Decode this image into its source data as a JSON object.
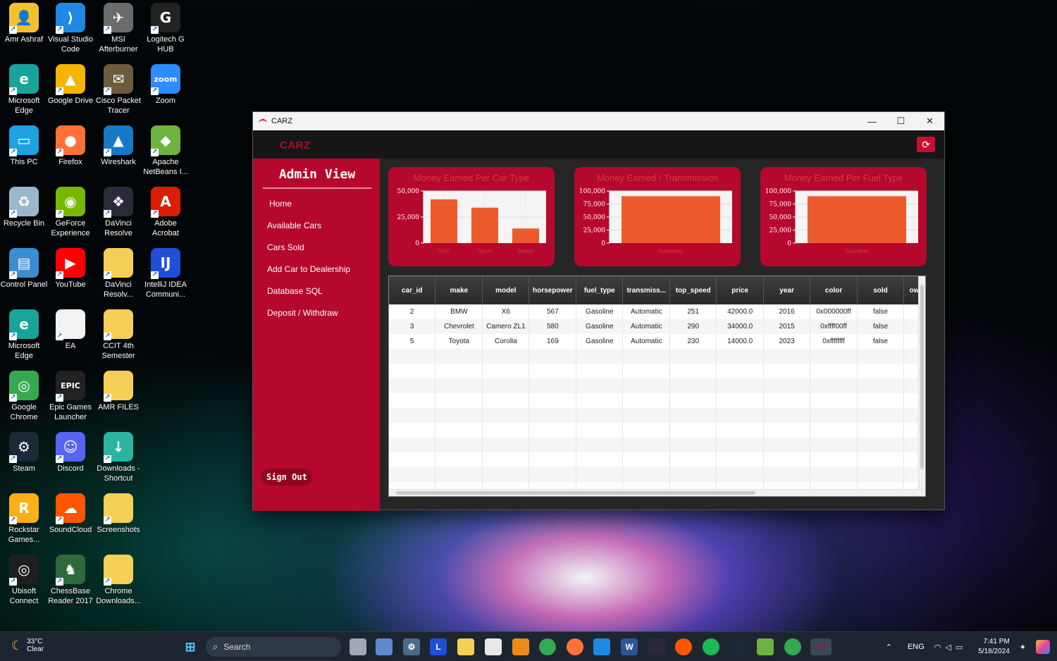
{
  "desktop": {
    "icons": [
      {
        "label": "Amr Ashraf",
        "icon": "user-folder-icon",
        "color": "#f2c12e",
        "glyph": "👤"
      },
      {
        "label": "Visual Studio Code",
        "icon": "vscode-icon",
        "color": "#1e88e5",
        "glyph": "⟩"
      },
      {
        "label": "MSI Afterburner",
        "icon": "msi-afterburner-icon",
        "color": "#6b6b6b",
        "glyph": "✈"
      },
      {
        "label": "Logitech G HUB",
        "icon": "logitech-ghub-icon",
        "color": "#222222",
        "glyph": "G"
      },
      {
        "label": "Microsoft Edge",
        "icon": "edge-icon",
        "color": "#1aa39a",
        "glyph": "e"
      },
      {
        "label": "Google Drive",
        "icon": "google-drive-icon",
        "color": "#f4b400",
        "glyph": "▲"
      },
      {
        "label": "Cisco Packet Tracer",
        "icon": "packet-tracer-icon",
        "color": "#6d5c3c",
        "glyph": "✉"
      },
      {
        "label": "Zoom",
        "icon": "zoom-icon",
        "color": "#2d8cff",
        "glyph": "zoom"
      },
      {
        "label": "This PC",
        "icon": "this-pc-icon",
        "color": "#1fa2e0",
        "glyph": "▭"
      },
      {
        "label": "Firefox",
        "icon": "firefox-icon",
        "color": "#ff7139",
        "glyph": "●"
      },
      {
        "label": "Wireshark",
        "icon": "wireshark-icon",
        "color": "#1679c5",
        "glyph": "▲"
      },
      {
        "label": "Apache NetBeans I...",
        "icon": "netbeans-icon",
        "color": "#6db33f",
        "glyph": "◆"
      },
      {
        "label": "Recycle Bin",
        "icon": "recycle-bin-icon",
        "color": "#9ab8cc",
        "glyph": "♻"
      },
      {
        "label": "GeForce Experience",
        "icon": "geforce-icon",
        "color": "#76b900",
        "glyph": "◉"
      },
      {
        "label": "DaVinci Resolve",
        "icon": "davinci-resolve-icon",
        "color": "#2a2a3a",
        "glyph": "❖"
      },
      {
        "label": "Adobe Acrobat",
        "icon": "adobe-acrobat-icon",
        "color": "#d81e05",
        "glyph": "A"
      },
      {
        "label": "Control Panel",
        "icon": "control-panel-icon",
        "color": "#3b8ed0",
        "glyph": "▤"
      },
      {
        "label": "YouTube",
        "icon": "youtube-icon",
        "color": "#ff0000",
        "glyph": "▶"
      },
      {
        "label": "DaVinci Resolv...",
        "icon": "folder-icon",
        "color": "#f6cf56",
        "glyph": ""
      },
      {
        "label": "IntelliJ IDEA Communi...",
        "icon": "intellij-icon",
        "color": "#1f4fd6",
        "glyph": "IJ"
      },
      {
        "label": "Microsoft Edge",
        "icon": "edge-icon",
        "color": "#1aa39a",
        "glyph": "e"
      },
      {
        "label": "EA",
        "icon": "file-icon",
        "color": "#f2f2f2",
        "glyph": ""
      },
      {
        "label": "CCIT 4th Semester",
        "icon": "folder-icon",
        "color": "#f6cf56",
        "glyph": ""
      },
      {
        "label": "",
        "icon": "empty",
        "color": "",
        "glyph": ""
      },
      {
        "label": "Google Chrome",
        "icon": "chrome-icon",
        "color": "#34a853",
        "glyph": "◎"
      },
      {
        "label": "Epic Games Launcher",
        "icon": "epic-games-icon",
        "color": "#222222",
        "glyph": "EPIC"
      },
      {
        "label": "AMR FILES",
        "icon": "folder-icon",
        "color": "#f6cf56",
        "glyph": ""
      },
      {
        "label": "",
        "icon": "empty",
        "color": "",
        "glyph": ""
      },
      {
        "label": "Steam",
        "icon": "steam-icon",
        "color": "#1b2838",
        "glyph": "⚙"
      },
      {
        "label": "Discord",
        "icon": "discord-icon",
        "color": "#5865f2",
        "glyph": "☺"
      },
      {
        "label": "Downloads - Shortcut",
        "icon": "downloads-folder-icon",
        "color": "#2bb5a0",
        "glyph": "↓"
      },
      {
        "label": "",
        "icon": "empty",
        "color": "",
        "glyph": ""
      },
      {
        "label": "Rockstar Games...",
        "icon": "rockstar-icon",
        "color": "#fcaf17",
        "glyph": "R"
      },
      {
        "label": "SoundCloud",
        "icon": "soundcloud-icon",
        "color": "#ff5500",
        "glyph": "☁"
      },
      {
        "label": "Screenshots",
        "icon": "folder-icon",
        "color": "#f6cf56",
        "glyph": ""
      },
      {
        "label": "",
        "icon": "empty",
        "color": "",
        "glyph": ""
      },
      {
        "label": "Ubisoft Connect",
        "icon": "ubisoft-icon",
        "color": "#1f1f1f",
        "glyph": "◎"
      },
      {
        "label": "ChessBase Reader 2017",
        "icon": "chessbase-icon",
        "color": "#2f6b3a",
        "glyph": "♞"
      },
      {
        "label": "Chrome Downloads...",
        "icon": "folder-icon",
        "color": "#f6cf56",
        "glyph": ""
      }
    ]
  },
  "window": {
    "title": "CARZ",
    "minimize": "—",
    "maximize": "☐",
    "close": "✕"
  },
  "app": {
    "brand": "CARZ",
    "refresh_glyph": "⟳",
    "sidebar": {
      "title": "Admin View",
      "items": [
        "Home",
        "Available Cars",
        "Cars Sold",
        "Add Car to Dealership",
        "Database SQL",
        "Deposit / Withdraw"
      ],
      "signout": "Sign Out"
    },
    "colors": {
      "accent": "#b5082c",
      "bar": "#ec5a2c"
    }
  },
  "chart_data": [
    {
      "type": "bar",
      "title": "Money Earned Per Car Type",
      "categories": [
        "SUV",
        "Sport",
        "Sedan"
      ],
      "values": [
        42000,
        34000,
        14000
      ],
      "yticks": [
        "50,000",
        "25,000",
        "0"
      ],
      "ylim": [
        0,
        50000
      ]
    },
    {
      "type": "bar",
      "title": "Money Earned / Transmission",
      "categories": [
        "Automatic"
      ],
      "values": [
        90000
      ],
      "yticks": [
        "100,000",
        "75,000",
        "50,000",
        "25,000",
        "0"
      ],
      "ylim": [
        0,
        100000
      ]
    },
    {
      "type": "bar",
      "title": "Money Earned Per Fuel Type",
      "categories": [
        "Gasoline"
      ],
      "values": [
        90000
      ],
      "yticks": [
        "100,000",
        "75,000",
        "50,000",
        "25,000",
        "0"
      ],
      "ylim": [
        0,
        100000
      ]
    }
  ],
  "table": {
    "columns": [
      "car_id",
      "make",
      "model",
      "horsepower",
      "fuel_type",
      "transmiss...",
      "top_speed",
      "price",
      "year",
      "color",
      "sold",
      "ow"
    ],
    "rows": [
      [
        "2",
        "BMW",
        "X6",
        "567",
        "Gasoline",
        "Automatic",
        "251",
        "42000.0",
        "2016",
        "0x000000ff",
        "false",
        ""
      ],
      [
        "3",
        "Chevrolet",
        "Camero ZL1",
        "580",
        "Gasoline",
        "Automatic",
        "290",
        "34000.0",
        "2015",
        "0xffff00ff",
        "false",
        ""
      ],
      [
        "5",
        "Toyota",
        "Corolla",
        "169",
        "Gasoline",
        "Automatic",
        "230",
        "14000.0",
        "2023",
        "0xffffffff",
        "false",
        ""
      ]
    ]
  },
  "taskbar": {
    "weather": {
      "temp": "33°C",
      "condition": "Clear"
    },
    "search_placeholder": "Search",
    "lang": "ENG",
    "time": "7:41 PM",
    "date": "5/18/2024"
  }
}
